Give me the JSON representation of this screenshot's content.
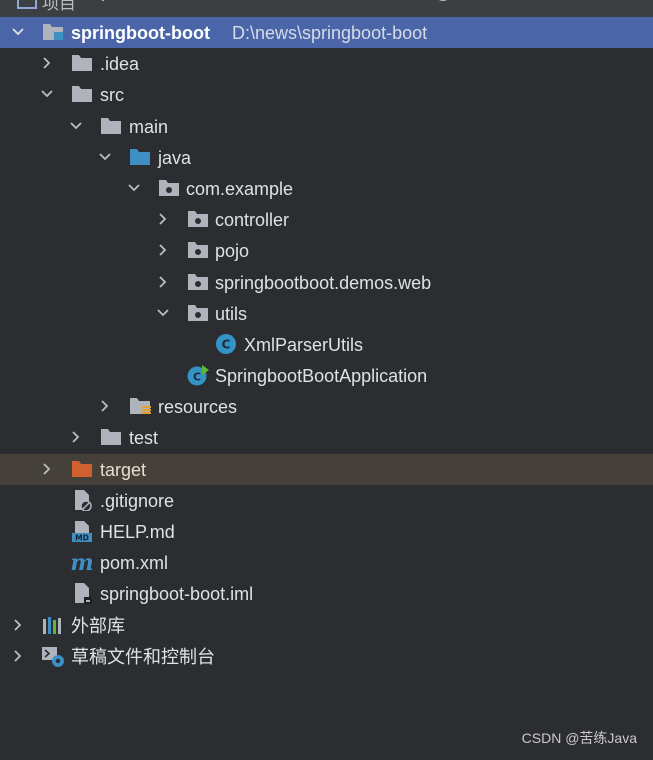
{
  "toolbar": {
    "title": "项目"
  },
  "tree": {
    "root": {
      "label": "springboot-boot",
      "path": "D:\\news\\springboot-boot"
    },
    "idea": "idea_placeholder",
    "items": [
      {
        "label": ".idea"
      },
      {
        "label": "src"
      },
      {
        "label": "main"
      },
      {
        "label": "java"
      },
      {
        "label": "com.example"
      },
      {
        "label": "controller"
      },
      {
        "label": "pojo"
      },
      {
        "label": "springbootboot.demos.web"
      },
      {
        "label": "utils"
      },
      {
        "label": "XmlParserUtils"
      },
      {
        "label": "SpringbootBootApplication"
      },
      {
        "label": "resources"
      },
      {
        "label": "test"
      },
      {
        "label": "target"
      },
      {
        "label": ".gitignore"
      },
      {
        "label": "HELP.md"
      },
      {
        "label": "pom.xml"
      },
      {
        "label": "springboot-boot.iml"
      },
      {
        "label": "外部库"
      },
      {
        "label": "草稿文件和控制台"
      }
    ]
  },
  "colors": {
    "selected_row": "#4a66a8",
    "excluded_row": "#45403a",
    "folder": "#aeb3bc",
    "source_folder": "#3d8fc4",
    "excluded_folder": "#d06030",
    "class_icon": "#3592c4"
  },
  "watermark": "CSDN @苦练Java"
}
